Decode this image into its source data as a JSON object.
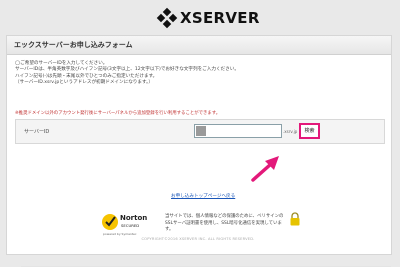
{
  "header": {
    "logo_text": "XSERVER"
  },
  "panel": {
    "title": "エックスサーバーお申し込みフォーム",
    "notes": [
      "◯ご希望のサーバーIDを入力してください。",
      "サーバーIDは、半角英数字及びハイフン記号(3文字以上、12文字以下)でお好きな文字列をご入力ください。",
      "ハイフン記号(-)は先頭・末尾以外でひとつのみご指定いただけます。",
      "（サーバーID.xsrv.jpというアドレスが初期ドメインになります。）"
    ],
    "note_red": "※推奨ドメイン以外のアカウント発行後にサーバーパネルから追加登録を行い利用することができます。"
  },
  "form": {
    "label": "サーバーID",
    "input_value": "",
    "suffix": ".xsrv.jp",
    "search_button": "検索"
  },
  "links": {
    "portal": "お申し込みトップページへ戻る"
  },
  "ssl": {
    "text": "当サイトでは、個人情報などの保護のために、ベリサインのSSLサーバ証明書を使用し、SSL暗号化通信を実現しています。",
    "norton_title": "Norton",
    "norton_sub": "SECURED",
    "norton_by": "powered by Symantec"
  },
  "footer": {
    "copyright": "COPYRIGHT©2016 XSERVER INC. ALL RIGHTS RESERVED."
  },
  "colors": {
    "highlight": "#e3197a",
    "link": "#1a56b8",
    "norton_yellow": "#f6c300"
  }
}
